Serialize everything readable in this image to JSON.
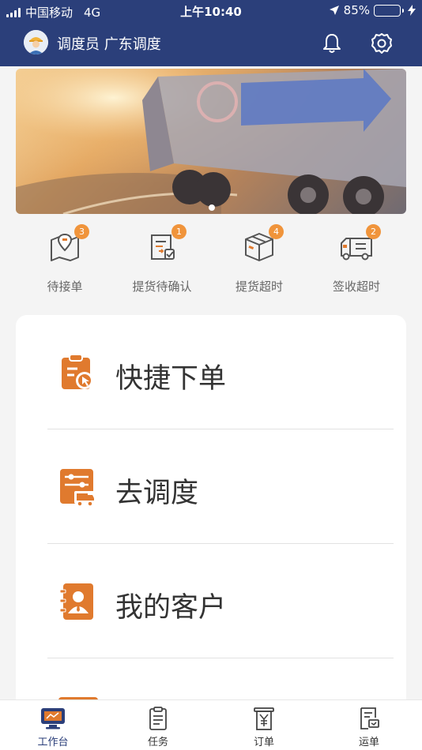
{
  "status_bar": {
    "carrier": "中国移动",
    "network": "4G",
    "time": "上午10:40",
    "battery_percent": "85%",
    "battery_level": 0.85
  },
  "header": {
    "title": "调度员 广东调度",
    "bell_icon": "bell-icon",
    "settings_icon": "gear-icon"
  },
  "banner": {
    "carousel_index": 1,
    "carousel_total": 1
  },
  "quick_items": [
    {
      "label": "待接单",
      "badge": "3",
      "icon": "map-pin-icon"
    },
    {
      "label": "提货待确认",
      "badge": "1",
      "icon": "clipboard-check-icon"
    },
    {
      "label": "提货超时",
      "badge": "4",
      "icon": "package-icon"
    },
    {
      "label": "签收超时",
      "badge": "2",
      "icon": "truck-icon"
    }
  ],
  "menu": [
    {
      "label": "快捷下单",
      "icon": "quick-order-icon"
    },
    {
      "label": "去调度",
      "icon": "dispatch-icon"
    },
    {
      "label": "我的客户",
      "icon": "contacts-icon"
    }
  ],
  "tabbar": [
    {
      "label": "工作台",
      "icon": "monitor-icon",
      "active": true
    },
    {
      "label": "任务",
      "icon": "clipboard-icon",
      "active": false
    },
    {
      "label": "订单",
      "icon": "yuan-receipt-icon",
      "active": false
    },
    {
      "label": "运单",
      "icon": "waybill-icon",
      "active": false
    }
  ],
  "colors": {
    "header_bg": "#2b3f7a",
    "accent_orange": "#e07a2e",
    "badge_orange": "#f0943b",
    "battery_green": "#4cd964"
  }
}
